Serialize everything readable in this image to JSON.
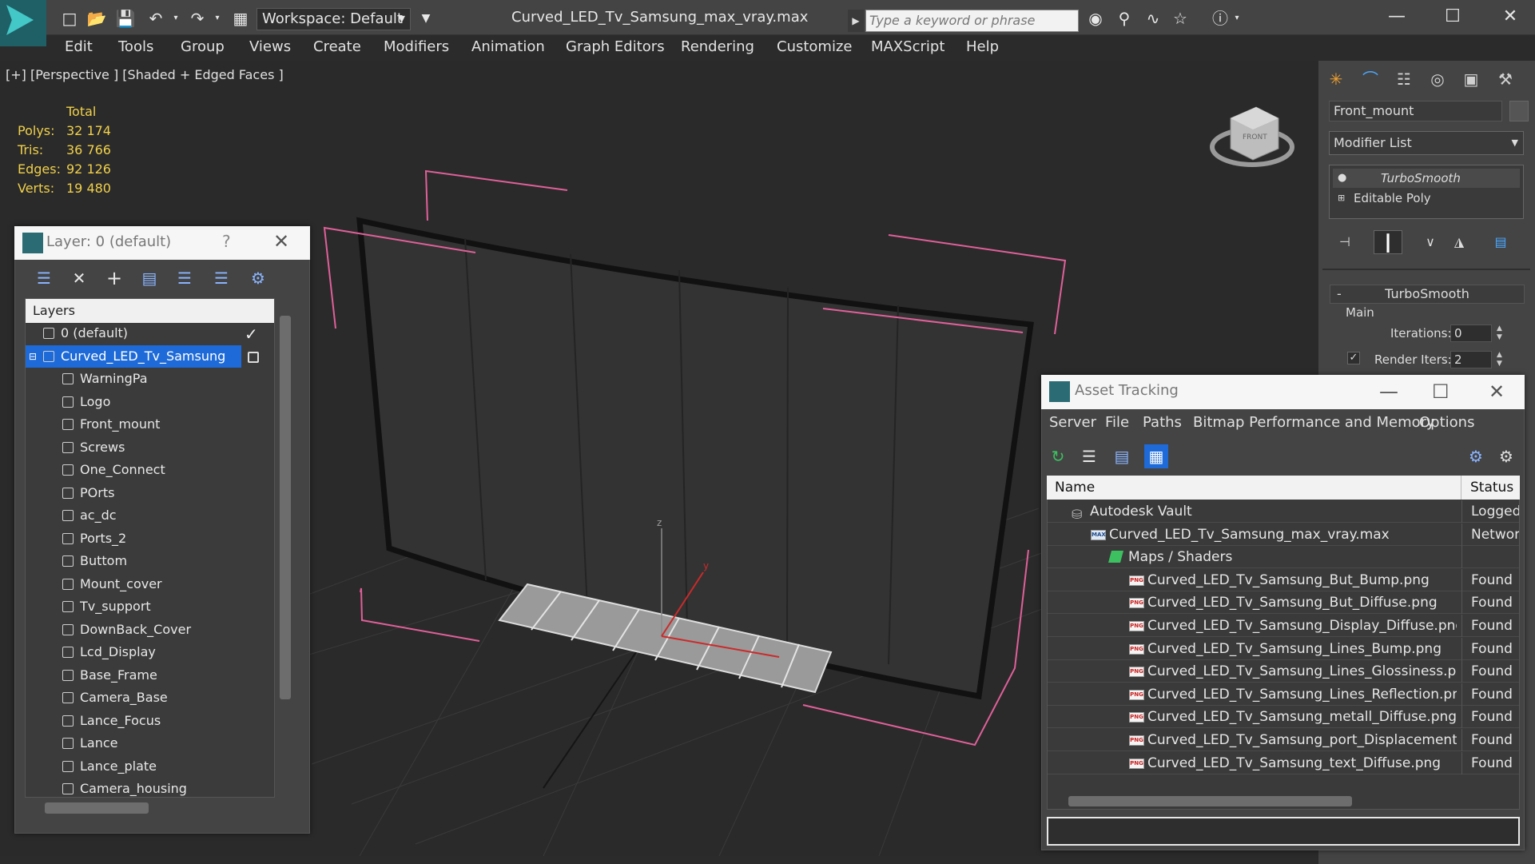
{
  "window": {
    "title": "Curved_LED_Tv_Samsung_max_vray.max",
    "workspace": "Workspace: Default",
    "search_placeholder": "Type a keyword or phrase"
  },
  "menu": [
    "Edit",
    "Tools",
    "Group",
    "Views",
    "Create",
    "Modifiers",
    "Animation",
    "Graph Editors",
    "Rendering",
    "Customize",
    "MAXScript",
    "Help"
  ],
  "viewport": {
    "label": "[+] [Perspective ] [Shaded + Edged Faces ]",
    "stats": {
      "header": "Total",
      "rows": [
        {
          "label": "Polys:",
          "value": "32 174"
        },
        {
          "label": "Tris:",
          "value": "36 766"
        },
        {
          "label": "Edges:",
          "value": "92 126"
        },
        {
          "label": "Verts:",
          "value": "19 480"
        }
      ]
    },
    "axis_z": "z",
    "axis_y": "y",
    "viewcube_label": "FRONT"
  },
  "command_panel": {
    "object_name": "Front_mount",
    "modifier_list": "Modifier List",
    "stack": [
      "TurboSmooth",
      "Editable Poly"
    ],
    "rollout": {
      "title": "TurboSmooth",
      "group": "Main",
      "iterations_label": "Iterations:",
      "iterations_value": "0",
      "render_iters_label": "Render Iters:",
      "render_iters_value": "2"
    }
  },
  "layer_dialog": {
    "title": "Layer: 0 (default)",
    "help": "?",
    "tree_header": "Layers",
    "rows": [
      {
        "label": "0 (default)",
        "level": 0
      },
      {
        "label": "Curved_LED_Tv_Samsung",
        "level": 0,
        "selected": true
      },
      {
        "label": "WarningPa",
        "level": 1
      },
      {
        "label": "Logo",
        "level": 1
      },
      {
        "label": "Front_mount",
        "level": 1
      },
      {
        "label": "Screws",
        "level": 1
      },
      {
        "label": "One_Connect",
        "level": 1
      },
      {
        "label": "POrts",
        "level": 1
      },
      {
        "label": "ac_dc",
        "level": 1
      },
      {
        "label": "Ports_2",
        "level": 1
      },
      {
        "label": "Buttom",
        "level": 1
      },
      {
        "label": "Mount_cover",
        "level": 1
      },
      {
        "label": "Tv_support",
        "level": 1
      },
      {
        "label": "DownBack_Cover",
        "level": 1
      },
      {
        "label": "Lcd_Display",
        "level": 1
      },
      {
        "label": "Base_Frame",
        "level": 1
      },
      {
        "label": "Camera_Base",
        "level": 1
      },
      {
        "label": "Lance_Focus",
        "level": 1
      },
      {
        "label": "Lance",
        "level": 1
      },
      {
        "label": "Lance_plate",
        "level": 1
      },
      {
        "label": "Camera_housing",
        "level": 1
      }
    ]
  },
  "asset_dialog": {
    "title": "Asset Tracking",
    "menu": [
      "Server",
      "File",
      "Paths",
      "Bitmap Performance and Memory",
      "Options"
    ],
    "col_name": "Name",
    "col_status": "Status",
    "rows": [
      {
        "name": "Autodesk Vault",
        "status": "Logged C",
        "level": 0,
        "icon": "vault"
      },
      {
        "name": "Curved_LED_Tv_Samsung_max_vray.max",
        "status": "Network",
        "level": 1,
        "icon": "max"
      },
      {
        "name": "Maps / Shaders",
        "status": "",
        "level": 2,
        "icon": "maps"
      },
      {
        "name": "Curved_LED_Tv_Samsung_But_Bump.png",
        "status": "Found",
        "level": 3,
        "icon": "png"
      },
      {
        "name": "Curved_LED_Tv_Samsung_But_Diffuse.png",
        "status": "Found",
        "level": 3,
        "icon": "png"
      },
      {
        "name": "Curved_LED_Tv_Samsung_Display_Diffuse.png",
        "status": "Found",
        "level": 3,
        "icon": "png"
      },
      {
        "name": "Curved_LED_Tv_Samsung_Lines_Bump.png",
        "status": "Found",
        "level": 3,
        "icon": "png"
      },
      {
        "name": "Curved_LED_Tv_Samsung_Lines_Glossiness.png",
        "status": "Found",
        "level": 3,
        "icon": "png"
      },
      {
        "name": "Curved_LED_Tv_Samsung_Lines_Reflection.png",
        "status": "Found",
        "level": 3,
        "icon": "png"
      },
      {
        "name": "Curved_LED_Tv_Samsung_metall_Diffuse.png",
        "status": "Found",
        "level": 3,
        "icon": "png"
      },
      {
        "name": "Curved_LED_Tv_Samsung_port_Displacement.p...",
        "status": "Found",
        "level": 3,
        "icon": "png"
      },
      {
        "name": "Curved_LED_Tv_Samsung_text_Diffuse.png",
        "status": "Found",
        "level": 3,
        "icon": "png"
      }
    ]
  },
  "colors": {
    "selection": "#1d6ad8",
    "stats_text": "#f0d04a",
    "bbox_lines": "#e0609a",
    "app_accent": "#43c7c7"
  }
}
